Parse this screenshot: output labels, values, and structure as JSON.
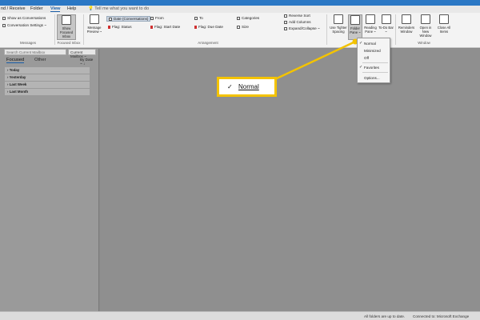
{
  "menubar": {
    "items": [
      "nd / Receive",
      "Folder",
      "View",
      "Help"
    ],
    "active": "View",
    "tell_me": "Tell me what you want to do"
  },
  "ribbon": {
    "messages": {
      "show_as_conversations": "Show as Conversations",
      "conversation_settings": "Conversation Settings ~",
      "group": "Messages"
    },
    "focused_inbox": {
      "button": "Show Focused Inbox",
      "group": "Focused Inbox"
    },
    "arrangement": {
      "message_preview": "Message Preview ~",
      "date": "Date (Conversations)",
      "from": "From",
      "to": "To",
      "categories": "Categories",
      "flag_status": "Flag: Status",
      "flag_start": "Flag: Start Date",
      "flag_due": "Flag: Due Date",
      "size": "Size",
      "reverse_sort": "Reverse Sort",
      "add_columns": "Add Columns",
      "expand_collapse": "Expand/Collapse ~",
      "group": "Arrangement"
    },
    "layout": {
      "tighter_spacing": "Use Tighter Spacing",
      "folder_pane": "Folder Pane ~",
      "reading_pane": "Reading Pane ~",
      "todo_bar": "To-Do Bar ~"
    },
    "window": {
      "reminders": "Reminders Window",
      "open_new": "Open in New Window",
      "close_all": "Close All Items",
      "group": "Window"
    }
  },
  "leftpane": {
    "search_placeholder": "Search Current Mailbox",
    "mailbox_scope": "Current Mailbox ~",
    "tab_focused": "Focused",
    "tab_other": "Other",
    "sort": "By Date ~ ↓",
    "groups": [
      "Today",
      "Yesterday",
      "Last Week",
      "Last Month"
    ]
  },
  "dropdown": {
    "items": [
      "Normal",
      "Minimized",
      "Off",
      "Favorites",
      "Options..."
    ],
    "checked": [
      "Normal",
      "Favorites"
    ]
  },
  "callout": {
    "label": "Normal"
  },
  "statusbar": {
    "left": "All folders are up to date.",
    "right": "Connected to: Microsoft Exchange"
  },
  "colors": {
    "accent": "#1a5ea8",
    "title_bar": "#2b78c5",
    "callout_border": "#f3c300"
  }
}
